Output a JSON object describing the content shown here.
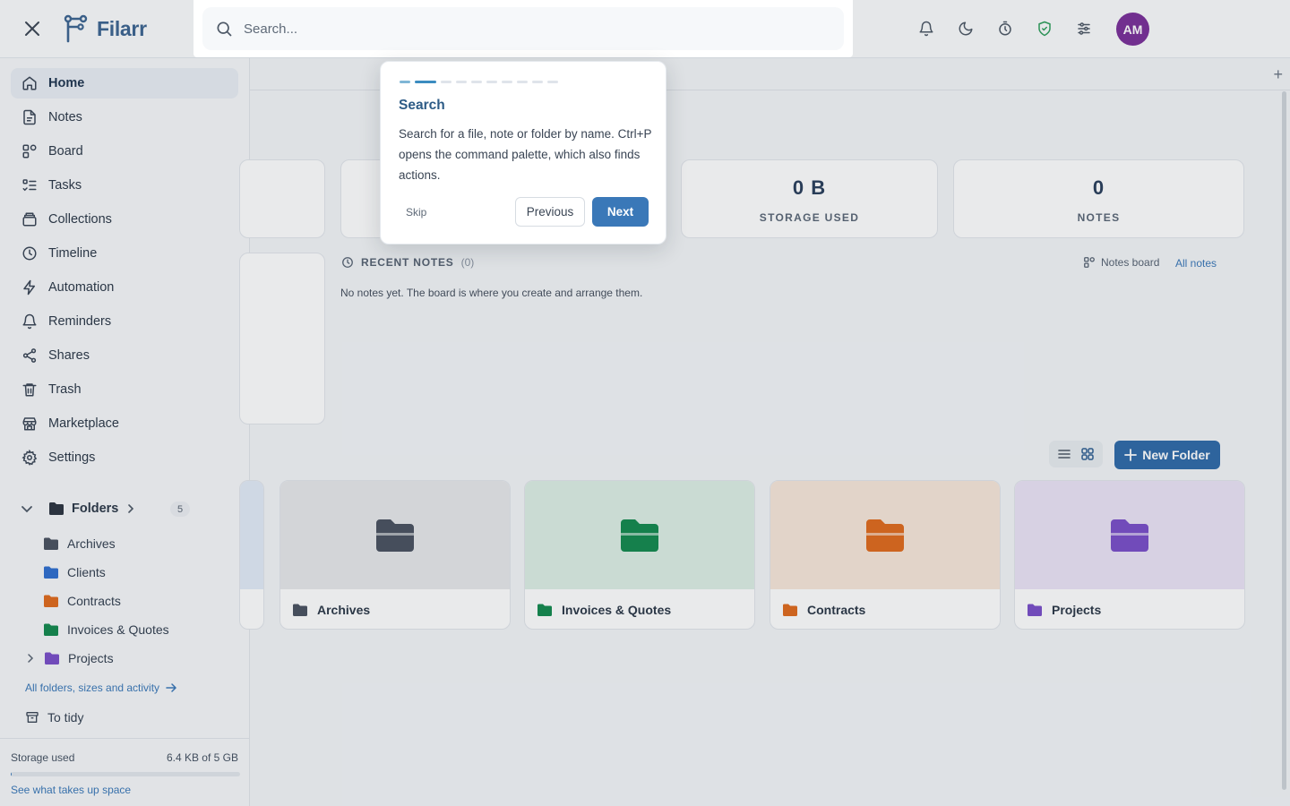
{
  "app": {
    "name": "Filarr",
    "avatar_initials": "AM"
  },
  "colors": {
    "accent": "#3a78b8",
    "brand": "#3d6591",
    "avatar": "#7a2f99",
    "shield": "#2e9e5b"
  },
  "topbar": {
    "icons": [
      "bell-icon",
      "moon-icon",
      "timer-icon",
      "shield-check-icon",
      "sliders-icon"
    ]
  },
  "search": {
    "placeholder": "Search..."
  },
  "sidebar": {
    "items": [
      {
        "label": "Home",
        "icon": "home-icon",
        "active": true
      },
      {
        "label": "Notes",
        "icon": "note-icon"
      },
      {
        "label": "Board",
        "icon": "board-icon"
      },
      {
        "label": "Tasks",
        "icon": "tasks-icon"
      },
      {
        "label": "Collections",
        "icon": "collections-icon"
      },
      {
        "label": "Timeline",
        "icon": "clock-icon"
      },
      {
        "label": "Automation",
        "icon": "lightning-icon"
      },
      {
        "label": "Reminders",
        "icon": "bell-icon"
      },
      {
        "label": "Shares",
        "icon": "share-icon"
      },
      {
        "label": "Trash",
        "icon": "trash-icon"
      },
      {
        "label": "Marketplace",
        "icon": "store-icon"
      },
      {
        "label": "Settings",
        "icon": "gear-icon"
      }
    ],
    "folders": {
      "label": "Folders",
      "count": "5",
      "items": [
        {
          "label": "Archives",
          "color": "#4a5260"
        },
        {
          "label": "Clients",
          "color": "#2f6fd0"
        },
        {
          "label": "Contracts",
          "color": "#e06a1c"
        },
        {
          "label": "Invoices & Quotes",
          "color": "#138a4e"
        },
        {
          "label": "Projects",
          "color": "#7a4fc9",
          "expandable": true
        }
      ],
      "all_link": "All folders, sizes and activity",
      "to_tidy": "To tidy"
    },
    "storage": {
      "label": "Storage used",
      "value": "6.4 KB of 5 GB",
      "fraction": 1.3e-06,
      "link": "See what takes up space"
    }
  },
  "main": {
    "stats": [
      {
        "value": "0 B",
        "label": "STORAGE USED"
      },
      {
        "value": "0",
        "label": "NOTES"
      }
    ],
    "recent_notes": {
      "title": "RECENT NOTES",
      "count": "(0)",
      "empty": "No notes yet. The board is where you create and arrange them.",
      "board_link": "Notes board",
      "all_link": "All notes"
    },
    "new_folder_label": "New Folder",
    "folder_cards": [
      {
        "name": "Archives",
        "color": "#4a5260",
        "tint": "#e7e8ea"
      },
      {
        "name": "Invoices & Quotes",
        "color": "#138a4e",
        "tint": "#ddefe5"
      },
      {
        "name": "Contracts",
        "color": "#e06a1c",
        "tint": "#f8e7da"
      },
      {
        "name": "Projects",
        "color": "#7a4fc9",
        "tint": "#ebe4f6"
      }
    ]
  },
  "tour": {
    "step": 2,
    "total": 10,
    "title": "Search",
    "body": "Search for a file, note or folder by name. Ctrl+P opens the command palette, which also finds actions.",
    "skip": "Skip",
    "previous": "Previous",
    "next": "Next"
  }
}
